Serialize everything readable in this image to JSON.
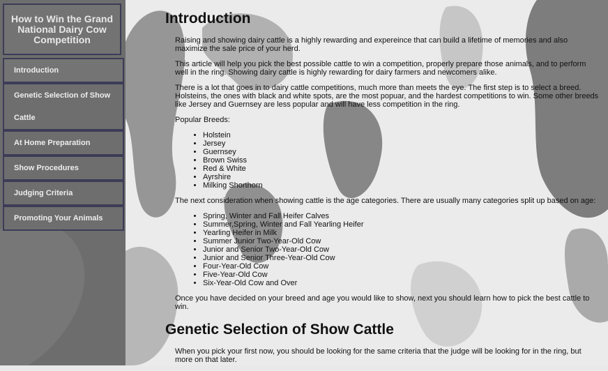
{
  "sidebar": {
    "title": "How to Win the Grand National Dairy Cow Competition",
    "nav": [
      {
        "label": "Introduction"
      },
      {
        "label": "Genetic Selection of Show Cattle"
      },
      {
        "label": "At Home Preparation"
      },
      {
        "label": "Show Procedures"
      },
      {
        "label": "Judging Criteria"
      },
      {
        "label": "Promoting Your Animals"
      }
    ]
  },
  "main": {
    "heading_intro": "Introduction",
    "p1": "Raising and showing dairy cattle is a highly rewarding and expereince that can build a lifetime of memories and also maximize the sale price of your herd.",
    "p2": "This article will help you pick the best possible cattle to win a competition, properly prepare those animals, and to perform well in the ring. Showing dairy cattle is highly rewarding for dairy farmers and newcomers alike.",
    "p3": "There is a lot that goes in to dairy cattle competitions, much more than meets the eye. The first step is to select a breed. Holsteins, the ones with black and white spots, are the most popuar, and the hardest competitions to win. Some other breeds like Jersey and Guernsey are less popular and will have less competition in the ring.",
    "popular_label": "Popular Breeds:",
    "breeds": [
      "Holstein",
      "Jersey",
      "Guernsey",
      "Brown Swiss",
      "Red & White",
      "Ayrshire",
      "Milking Shorthorn"
    ],
    "p4": "The next consideration when showing cattle is the age categories. There are usually many categories split up based on age:",
    "ages": [
      "Spring, Winter and Fall Heifer Calves",
      "Summer,Spring, Winter and Fall Yearling Heifer",
      "Yearling Heifer in Milk",
      "Summer Junior Two-Year-Old Cow",
      "Junior and Senior Two-Year-Old Cow",
      "Junior and Senior Three-Year-Old Cow",
      "Four-Year-Old Cow",
      "Five-Year-Old Cow",
      "Six-Year-Old Cow and Over"
    ],
    "p5": "Once you have decided on your breed and age you would like to show, next you should learn how to pick the best cattle to win.",
    "heading_genetic": "Genetic Selection of Show Cattle",
    "p6": "When you pick your first now, you should be looking for the same criteria that the judge will be looking for in the ring, but more on that later."
  }
}
